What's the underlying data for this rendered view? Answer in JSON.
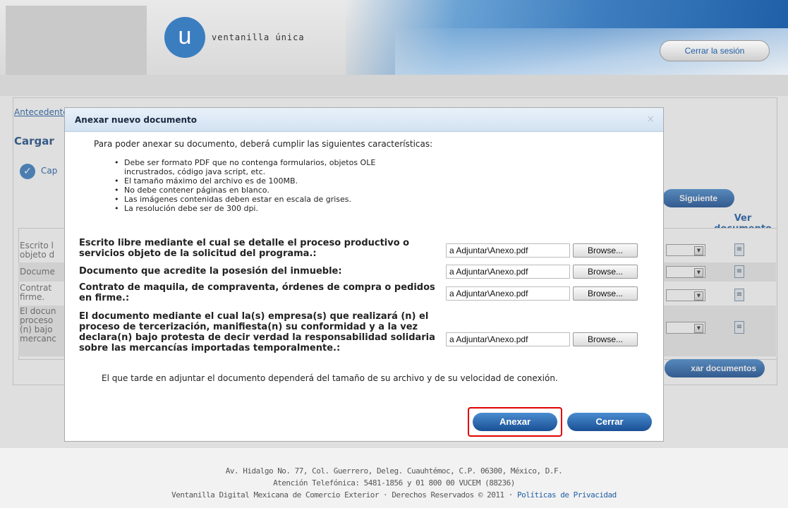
{
  "header": {
    "logo_letter": "u",
    "logo_text": "ventanilla única",
    "logout_label": "Cerrar la sesión"
  },
  "page": {
    "breadcrumb": "Antecedentes",
    "title": "Cargar",
    "check_label": "Cap",
    "next_label": "Siguiente",
    "ver_documento": "Ver documento",
    "rows": [
      {
        "label": "Escrito l objeto d"
      },
      {
        "label": "Docume"
      },
      {
        "label": "Contrat firme."
      },
      {
        "label": "El docun proceso (n) bajo mercanc"
      }
    ],
    "attach_docs_label": "xar documentos"
  },
  "modal": {
    "title": "Anexar nuevo documento",
    "close": "×",
    "intro": "Para poder anexar su documento, deberá cumplir las siguientes características:",
    "requirements": [
      "Debe ser formato PDF que no contenga formularios, objetos OLE incrustrados, código java script, etc.",
      "El tamaño máximo del archivo es de 100MB.",
      "No debe contener páginas en blanco.",
      "Las imágenes contenidas deben estar en escala de grises.",
      "La resolución debe ser de 300 dpi."
    ],
    "documents": [
      {
        "label": "Escrito libre mediante el cual se detalle el proceso productivo o servicios objeto de la solicitud del programa.:",
        "file": "a Adjuntar\\Anexo.pdf"
      },
      {
        "label": "Documento que acredite la posesión del inmueble:",
        "file": "a Adjuntar\\Anexo.pdf"
      },
      {
        "label": "Contrato de maquila, de compraventa, órdenes de compra o pedidos en firme.:",
        "file": "a Adjuntar\\Anexo.pdf"
      },
      {
        "label": "El documento mediante el cual la(s) empresa(s) que realizará (n) el proceso de tercerización, manifiesta(n) su conformidad y a la vez declara(n) bajo protesta de decir verdad la responsabilidad solidaria sobre las mercancías importadas temporalmente.:",
        "file": "a Adjuntar\\Anexo.pdf"
      }
    ],
    "browse_label": "Browse...",
    "note": "El que tarde en adjuntar el documento dependerá del tamaño de su archivo y de su velocidad de conexión.",
    "anexar_label": "Anexar",
    "cerrar_label": "Cerrar"
  },
  "footer": {
    "address": "Av. Hidalgo No. 77, Col. Guerrero, Deleg. Cuauhtémoc, C.P. 06300, México, D.F.",
    "phone": "Atención Telefónica: 5481-1856 y 01 800 00 VUCEM (88236)",
    "copyright": "Ventanilla Digital Mexicana de Comercio Exterior · Derechos Reservados © 2011 · ",
    "privacy_link": "Políticas de Privacidad"
  }
}
